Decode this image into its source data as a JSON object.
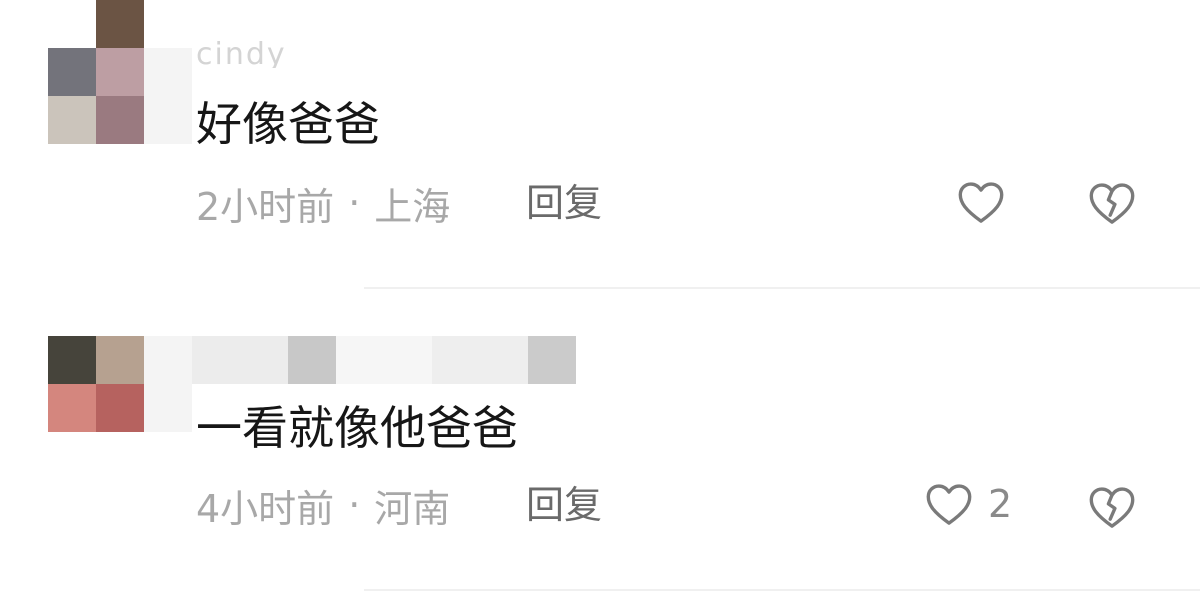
{
  "comments": [
    {
      "username": "cindy",
      "text": "好像爸爸",
      "time": "2小时前",
      "separator": "·",
      "location": "上海",
      "reply_label": "回复",
      "like_count": "",
      "avatar_colors": [
        "#6b5444",
        "#73737b",
        "#bd9ea3",
        "#cbc4bb",
        "#9a7a80"
      ]
    },
    {
      "username": "",
      "text": "一看就像他爸爸",
      "time": "4小时前",
      "separator": "·",
      "location": "河南",
      "reply_label": "回复",
      "like_count": "2",
      "avatar_colors": [
        "#46443b",
        "#b6a190",
        "#d4867e",
        "#b6625f"
      ]
    }
  ],
  "colors": {
    "text_primary": "#161616",
    "text_meta": "#a8a8a8",
    "reply": "#6a6a6a",
    "icon": "#7a7a7a",
    "divider": "#f0f0f0"
  },
  "icons": {
    "like": "heart-outline-icon",
    "dislike": "broken-heart-icon"
  }
}
